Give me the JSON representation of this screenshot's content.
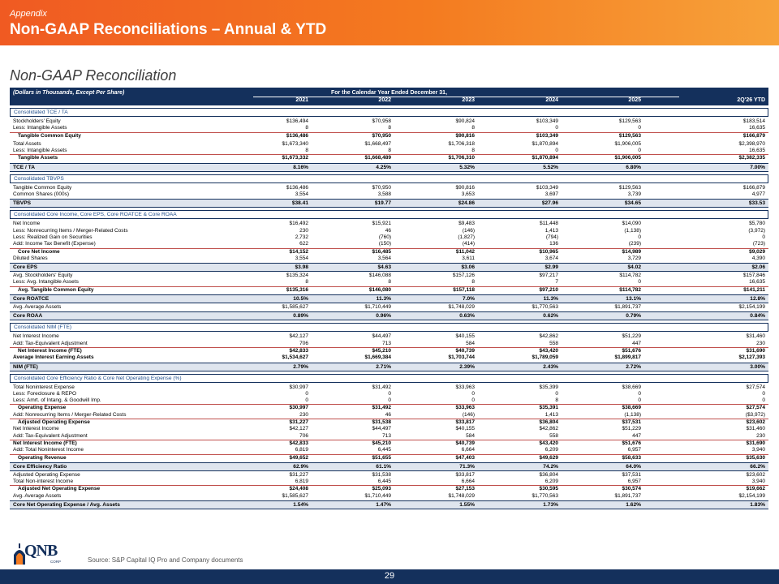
{
  "header": {
    "pre_title": "Appendix",
    "title": "Non-GAAP Reconciliations – Annual & YTD"
  },
  "subtitle": "Non-GAAP Reconciliation",
  "table": {
    "units_label": "(Dollars in Thousands, Except Per Share)",
    "period_label": "For the Calendar Year Ended December 31,",
    "columns": [
      "2021",
      "2022",
      "2023",
      "2024",
      "2025",
      "2Q'26 YTD"
    ],
    "sections": [
      {
        "title": "Consolidated TCE / TA",
        "rows": [
          {
            "label": "Stockholders' Equity",
            "values": [
              "$136,494",
              "$70,958",
              "$90,824",
              "$103,349",
              "$129,563",
              "$183,514"
            ]
          },
          {
            "label": "Less: Intangible Assets",
            "values": [
              "8",
              "8",
              "8",
              "0",
              "0",
              "16,635"
            ],
            "style": "uline"
          },
          {
            "label": "Tangible Common Equity",
            "values": [
              "$136,486",
              "$70,950",
              "$90,816",
              "$103,349",
              "$129,563",
              "$166,879"
            ],
            "style": "bold indent"
          },
          {
            "label": "Total Assets",
            "values": [
              "$1,673,340",
              "$1,668,497",
              "$1,706,318",
              "$1,870,894",
              "$1,906,005",
              "$2,398,970"
            ],
            "style": "gapbefore"
          },
          {
            "label": "Less: Intangible Assets",
            "values": [
              "8",
              "8",
              "8",
              "0",
              "0",
              "16,635"
            ],
            "style": "uline"
          },
          {
            "label": "Tangible Assets",
            "values": [
              "$1,673,332",
              "$1,668,489",
              "$1,706,310",
              "$1,870,894",
              "$1,906,005",
              "$2,382,335"
            ],
            "style": "bold indent"
          }
        ],
        "metric": {
          "label": "TCE / TA",
          "values": [
            "8.16%",
            "4.25%",
            "5.32%",
            "5.52%",
            "6.80%",
            "7.00%"
          ]
        }
      },
      {
        "title": "Consolidated TBVPS",
        "rows": [
          {
            "label": "Tangible Common Equity",
            "values": [
              "$136,486",
              "$70,950",
              "$90,816",
              "$103,349",
              "$129,563",
              "$166,879"
            ]
          },
          {
            "label": "Common Shares (000s)",
            "values": [
              "3,554",
              "3,588",
              "3,653",
              "3,697",
              "3,739",
              "4,977"
            ]
          }
        ],
        "metric": {
          "label": "TBVPS",
          "values": [
            "$38.41",
            "$19.77",
            "$24.86",
            "$27.96",
            "$34.65",
            "$33.53"
          ]
        }
      },
      {
        "title": "Consolidated Core Income, Core EPS, Core ROATCE & Core ROAA",
        "rows": [
          {
            "label": "Net Income",
            "values": [
              "$16,492",
              "$15,921",
              "$9,483",
              "$11,448",
              "$14,090",
              "$5,780"
            ]
          },
          {
            "label": "Less: Nonrecurring Items / Merger-Related Costs",
            "values": [
              "230",
              "46",
              "(146)",
              "1,413",
              "(1,138)",
              "(3,972)"
            ]
          },
          {
            "label": "Less: Realized Gain on Securities",
            "values": [
              "2,732",
              "(760)",
              "(1,827)",
              "(794)",
              "0",
              "0"
            ]
          },
          {
            "label": "Add: Income Tax Benefit (Expense)",
            "values": [
              "622",
              "(150)",
              "(414)",
              "136",
              "(239)",
              "(723)"
            ],
            "style": "uline"
          },
          {
            "label": "Core Net Income",
            "values": [
              "$14,152",
              "$16,485",
              "$11,042",
              "$10,965",
              "$14,989",
              "$9,029"
            ],
            "style": "bold indent"
          },
          {
            "label": "Diluted Shares",
            "values": [
              "3,554",
              "3,564",
              "3,611",
              "3,674",
              "3,729",
              "4,390"
            ]
          }
        ],
        "metric": {
          "label": "Core EPS",
          "values": [
            "$3.98",
            "$4.63",
            "$3.06",
            "$2.99",
            "$4.02",
            "$2.06"
          ]
        },
        "rows2": [
          {
            "label": "Avg. Stockholders' Equity",
            "values": [
              "$135,324",
              "$146,088",
              "$157,126",
              "$97,217",
              "$114,782",
              "$157,846"
            ]
          },
          {
            "label": "Less: Avg. Intangible Assets",
            "values": [
              "8",
              "8",
              "8",
              "7",
              "0",
              "16,635"
            ],
            "style": "uline"
          },
          {
            "label": "Avg. Tangible Common Equity",
            "values": [
              "$135,316",
              "$146,080",
              "$157,118",
              "$97,210",
              "$114,782",
              "$141,211"
            ],
            "style": "bold indent"
          }
        ],
        "metric2": {
          "label": "Core ROATCE",
          "values": [
            "10.5%",
            "11.3%",
            "7.0%",
            "11.3%",
            "13.1%",
            "12.8%"
          ]
        },
        "rows3": [
          {
            "label": "Avg. Average Assets",
            "values": [
              "$1,585,627",
              "$1,710,449",
              "$1,748,029",
              "$1,770,563",
              "$1,891,737",
              "$2,154,199"
            ]
          }
        ],
        "metric3": {
          "label": "Core ROAA",
          "values": [
            "0.89%",
            "0.96%",
            "0.63%",
            "0.62%",
            "0.79%",
            "0.84%"
          ]
        }
      },
      {
        "title": "Consolidated NIM (FTE)",
        "rows": [
          {
            "label": "Net Interest Income",
            "values": [
              "$42,127",
              "$44,497",
              "$40,155",
              "$42,862",
              "$51,229",
              "$31,460"
            ]
          },
          {
            "label": "Add: Tax-Equivalent Adjustment",
            "values": [
              "706",
              "713",
              "584",
              "558",
              "447",
              "230"
            ],
            "style": "uline"
          },
          {
            "label": "Net Interest Income (FTE)",
            "values": [
              "$42,833",
              "$45,210",
              "$40,739",
              "$43,420",
              "$51,676",
              "$31,690"
            ],
            "style": "bold indent"
          },
          {
            "label": "Average Interest Earning Assets",
            "values": [
              "$1,534,627",
              "$1,669,384",
              "$1,703,744",
              "$1,789,059",
              "$1,899,817",
              "$2,127,393"
            ],
            "style": "bold"
          }
        ],
        "metric": {
          "label": "NIM (FTE)",
          "values": [
            "2.79%",
            "2.71%",
            "2.39%",
            "2.43%",
            "2.72%",
            "3.00%"
          ]
        }
      },
      {
        "title": "Consolidated Core Efficiency Ratio & Core Net Operating Expense (%)",
        "rows": [
          {
            "label": "Total Noninterest Expense",
            "values": [
              "$30,997",
              "$31,492",
              "$33,963",
              "$35,399",
              "$38,669",
              "$27,574"
            ]
          },
          {
            "label": "Less: Foreclosure & REPO",
            "values": [
              "0",
              "0",
              "0",
              "0",
              "0",
              "0"
            ]
          },
          {
            "label": "Less: Amrt. of Intang. & Goodwill Imp.",
            "values": [
              "0",
              "0",
              "0",
              "8",
              "0",
              "0"
            ],
            "style": "uline"
          },
          {
            "label": "Operating Expense",
            "values": [
              "$30,997",
              "$31,492",
              "$33,963",
              "$35,391",
              "$38,669",
              "$27,574"
            ],
            "style": "bold indent"
          },
          {
            "label": "Add: Nonrecurring Items / Merger-Related Costs",
            "values": [
              "230",
              "46",
              "(146)",
              "1,413",
              "(1,138)",
              "($3,972)"
            ],
            "style": "uline"
          },
          {
            "label": "Adjusted Operating Expense",
            "values": [
              "$31,227",
              "$31,538",
              "$33,817",
              "$36,804",
              "$37,531",
              "$23,602"
            ],
            "style": "bold indent"
          },
          {
            "label": "Net Interest Income",
            "values": [
              "$42,127",
              "$44,497",
              "$40,155",
              "$42,862",
              "$51,229",
              "$31,460"
            ]
          },
          {
            "label": "Add: Tax-Equivalent Adjustment",
            "values": [
              "706",
              "713",
              "584",
              "558",
              "447",
              "230"
            ],
            "style": "uline"
          },
          {
            "label": "Net Interest Income (FTE)",
            "values": [
              "$42,833",
              "$45,210",
              "$40,739",
              "$43,420",
              "$51,676",
              "$31,690"
            ],
            "style": "bold"
          },
          {
            "label": "Add: Total Noninterest Income",
            "values": [
              "6,819",
              "6,445",
              "6,664",
              "6,209",
              "6,957",
              "3,940"
            ],
            "style": "uline"
          },
          {
            "label": "Operating Revenue",
            "values": [
              "$49,652",
              "$51,655",
              "$47,403",
              "$49,629",
              "$58,633",
              "$35,630"
            ],
            "style": "bold indent"
          }
        ],
        "metric": {
          "label": "Core Efficiency Ratio",
          "values": [
            "62.9%",
            "61.1%",
            "71.3%",
            "74.2%",
            "64.0%",
            "66.2%"
          ]
        },
        "rows2": [
          {
            "label": "Adjusted Operating Expense",
            "values": [
              "$31,227",
              "$31,538",
              "$33,817",
              "$36,804",
              "$37,531",
              "$23,602"
            ]
          },
          {
            "label": "Total Non-interest Income",
            "values": [
              "6,819",
              "6,445",
              "6,664",
              "6,209",
              "6,957",
              "3,940"
            ],
            "style": "uline"
          },
          {
            "label": "Adjusted Net Operating Expense",
            "values": [
              "$24,408",
              "$25,093",
              "$27,153",
              "$30,595",
              "$30,574",
              "$19,662"
            ],
            "style": "bold indent"
          },
          {
            "label": "Avg. Average Assets",
            "values": [
              "$1,585,627",
              "$1,710,449",
              "$1,748,029",
              "$1,770,563",
              "$1,891,737",
              "$2,154,199"
            ]
          }
        ],
        "metric2": {
          "label": "Core Net Operating Expense / Avg. Assets",
          "values": [
            "1.54%",
            "1.47%",
            "1.55%",
            "1.73%",
            "1.62%",
            "1.83%"
          ]
        }
      }
    ]
  },
  "footer": {
    "source": "Source: S&P Capital IQ Pro and Company documents",
    "page_number": "29",
    "logo_text": "QNB",
    "logo_sub": "CORP"
  },
  "colors": {
    "header_orange": "#f05a22",
    "navy": "#14305c",
    "section_text": "#1f4e8c",
    "rule_red": "#c0504d"
  }
}
